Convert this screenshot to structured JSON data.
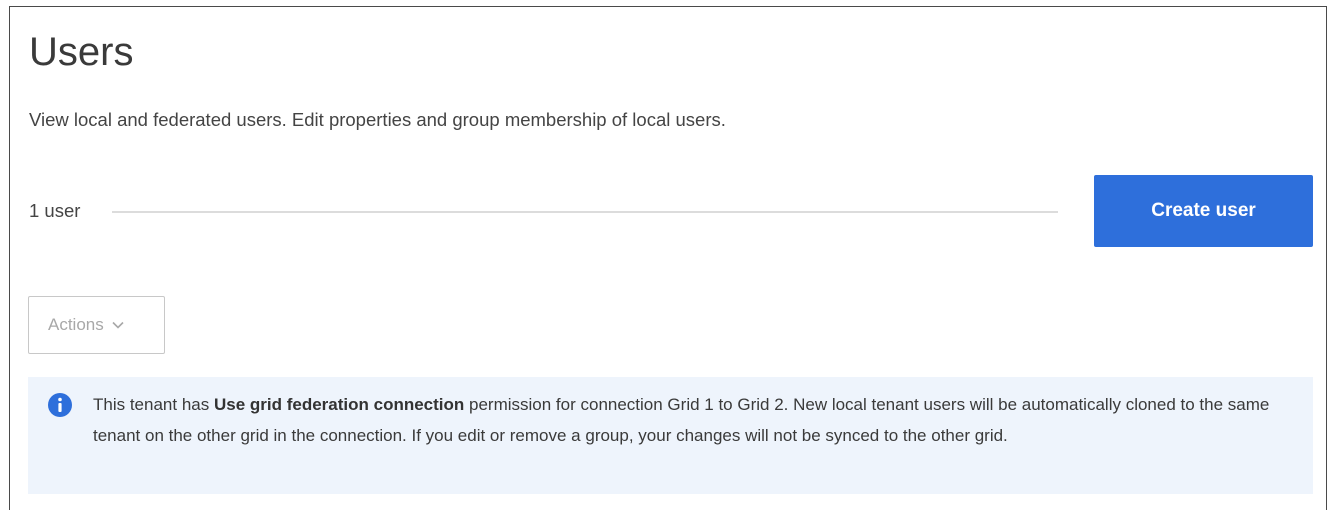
{
  "page": {
    "title": "Users",
    "description": "View local and federated users. Edit properties and group membership of local users."
  },
  "toolbar": {
    "user_count": "1 user",
    "create_user_label": "Create user",
    "actions_label": "Actions",
    "actions_icon": "chevron-down-icon"
  },
  "banner": {
    "icon": "info-icon",
    "text_before": "This tenant has ",
    "text_bold": "Use grid federation connection",
    "text_after": " permission for connection Grid 1 to Grid 2. New local tenant users will be automatically cloned to the same tenant on the other grid in the connection. If you edit or remove a group, your changes will not be synced to the other grid."
  },
  "colors": {
    "primary_button": "#2e6fdb",
    "banner_background": "#eef4fc",
    "info_icon": "#2e6fdb",
    "disabled_text": "#a8a8a8"
  }
}
